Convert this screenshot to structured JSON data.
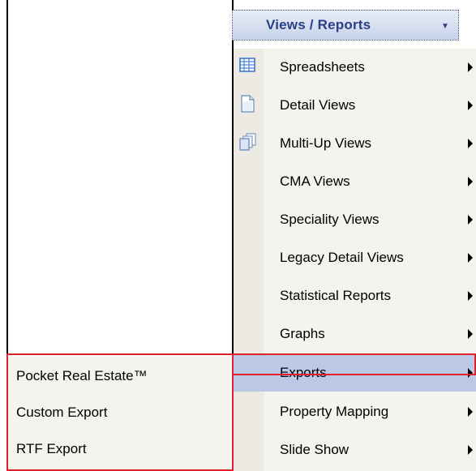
{
  "toolbar": {
    "views_reports_label": "Views / Reports",
    "dropdown_arrow": "˅"
  },
  "menu": {
    "items": [
      {
        "label": "Spreadsheets",
        "icon": "spreadsheet-icon"
      },
      {
        "label": "Detail Views",
        "icon": "document-icon"
      },
      {
        "label": "Multi-Up Views",
        "icon": "stacked-documents-icon"
      },
      {
        "label": "CMA Views",
        "icon": ""
      },
      {
        "label": "Speciality Views",
        "icon": ""
      },
      {
        "label": "Legacy Detail Views",
        "icon": ""
      },
      {
        "label": "Statistical Reports",
        "icon": ""
      },
      {
        "label": "Graphs",
        "icon": ""
      },
      {
        "label": "Exports",
        "icon": "",
        "highlighted": true
      },
      {
        "label": "Property Mapping",
        "icon": ""
      },
      {
        "label": "Slide Show",
        "icon": ""
      }
    ]
  },
  "submenu": {
    "items": [
      {
        "label": "Pocket Real Estate™"
      },
      {
        "label": "Custom Export"
      },
      {
        "label": "RTF Export"
      }
    ]
  },
  "colors": {
    "highlight": "#bcc9e6",
    "annotation_red": "#e0202a",
    "button_text": "#2b3f87"
  }
}
